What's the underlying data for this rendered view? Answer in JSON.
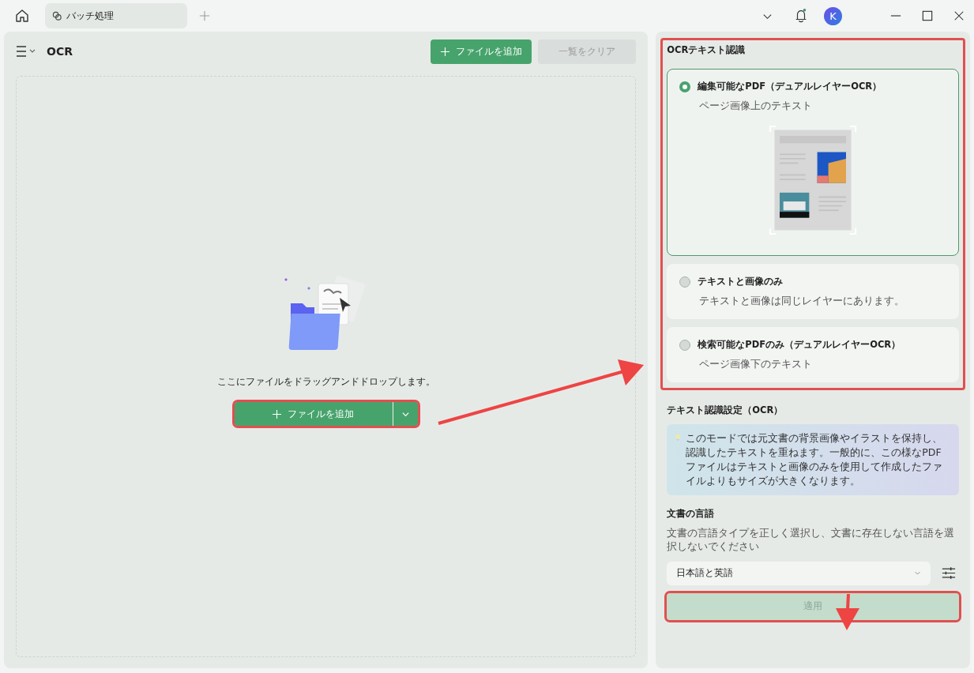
{
  "tab_bar": {
    "tabs": [
      {
        "label": "バッチ処理",
        "selected": true
      }
    ]
  },
  "user": {
    "initial": "K"
  },
  "notifications": {
    "unread": true
  },
  "left_panel": {
    "title": "OCR",
    "buttons": [
      {
        "label": "ファイルを追加",
        "kind": "primary",
        "disabled": false
      },
      {
        "label": "一覧をクリア",
        "kind": "secondary",
        "disabled": true
      }
    ],
    "drop_zone": {
      "hint": "ここにファイルをドラッグアンドドロップします。",
      "button": "ファイルを追加",
      "highlighted": true
    }
  },
  "ocr": {
    "title": "OCRテキスト認識",
    "highlighted": true,
    "options": [
      {
        "label": "編集可能なPDF（デュアルレイヤーOCR）",
        "description": "ページ画像上のテキスト",
        "selected": true
      },
      {
        "label": "テキストと画像のみ",
        "description": "テキストと画像は同じレイヤーにあります。",
        "selected": false
      },
      {
        "label": "検索可能なPDFのみ（デュアルレイヤーOCR）",
        "description": "ページ画像下のテキスト",
        "selected": false
      }
    ]
  },
  "settings": {
    "title": "テキスト認識設定（OCR）",
    "info": "このモードでは元文書の背景画像やイラストを保持し、認識したテキストを重ねます。一般的に、この様なPDFファイルはテキストと画像のみを使用して作成したファイルよりもサイズが大きくなります。"
  },
  "language": {
    "title": "文書の言語",
    "description": "文書の言語タイプを正しく選択し、文書に存在しない言語を選択しないでください",
    "value": "日本語と英語"
  },
  "apply": {
    "label": "適用",
    "disabled": true,
    "highlighted": true
  }
}
